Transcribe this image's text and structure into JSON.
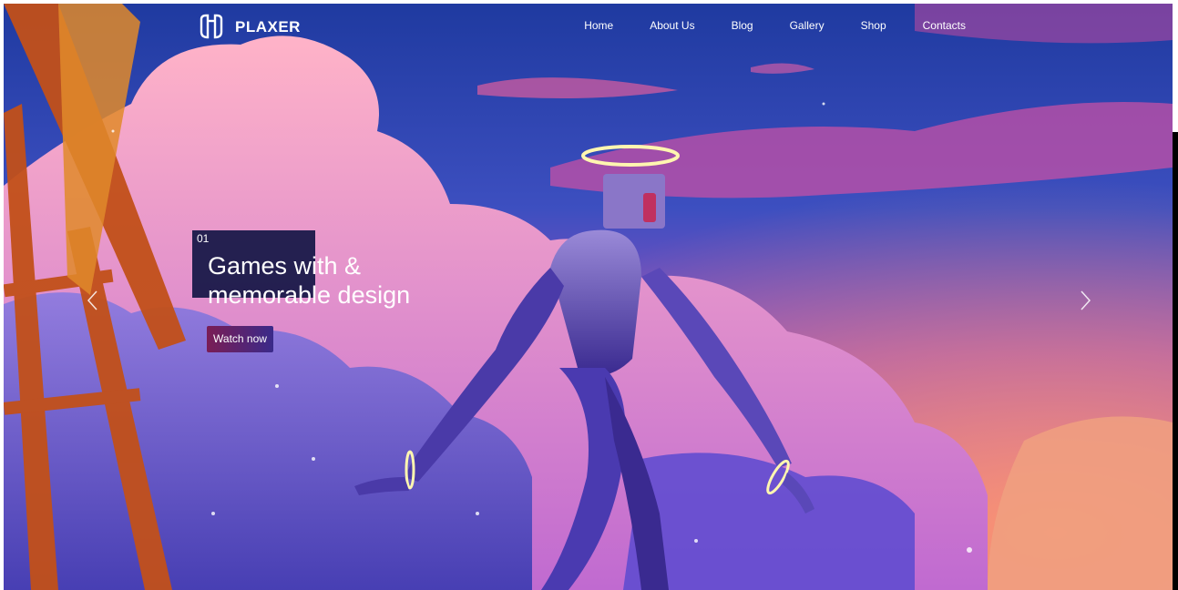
{
  "brand": {
    "name": "PLAXER"
  },
  "nav": {
    "items": [
      {
        "label": "Home"
      },
      {
        "label": "About Us"
      },
      {
        "label": "Blog"
      },
      {
        "label": "Gallery"
      },
      {
        "label": "Shop"
      },
      {
        "label": "Contacts"
      }
    ]
  },
  "hero": {
    "slide_number": "01",
    "title_line1": "Games with &",
    "title_line2": "memorable design",
    "cta_label": "Watch now",
    "prev_icon": "chevron-left-icon",
    "next_icon": "chevron-right-icon"
  },
  "colors": {
    "sky_top": "#2a3aa8",
    "sky_mid": "#7a4ab8",
    "sky_bottom": "#d85aa8",
    "accent_button": "#7a1d55",
    "title_block": "#141645"
  }
}
